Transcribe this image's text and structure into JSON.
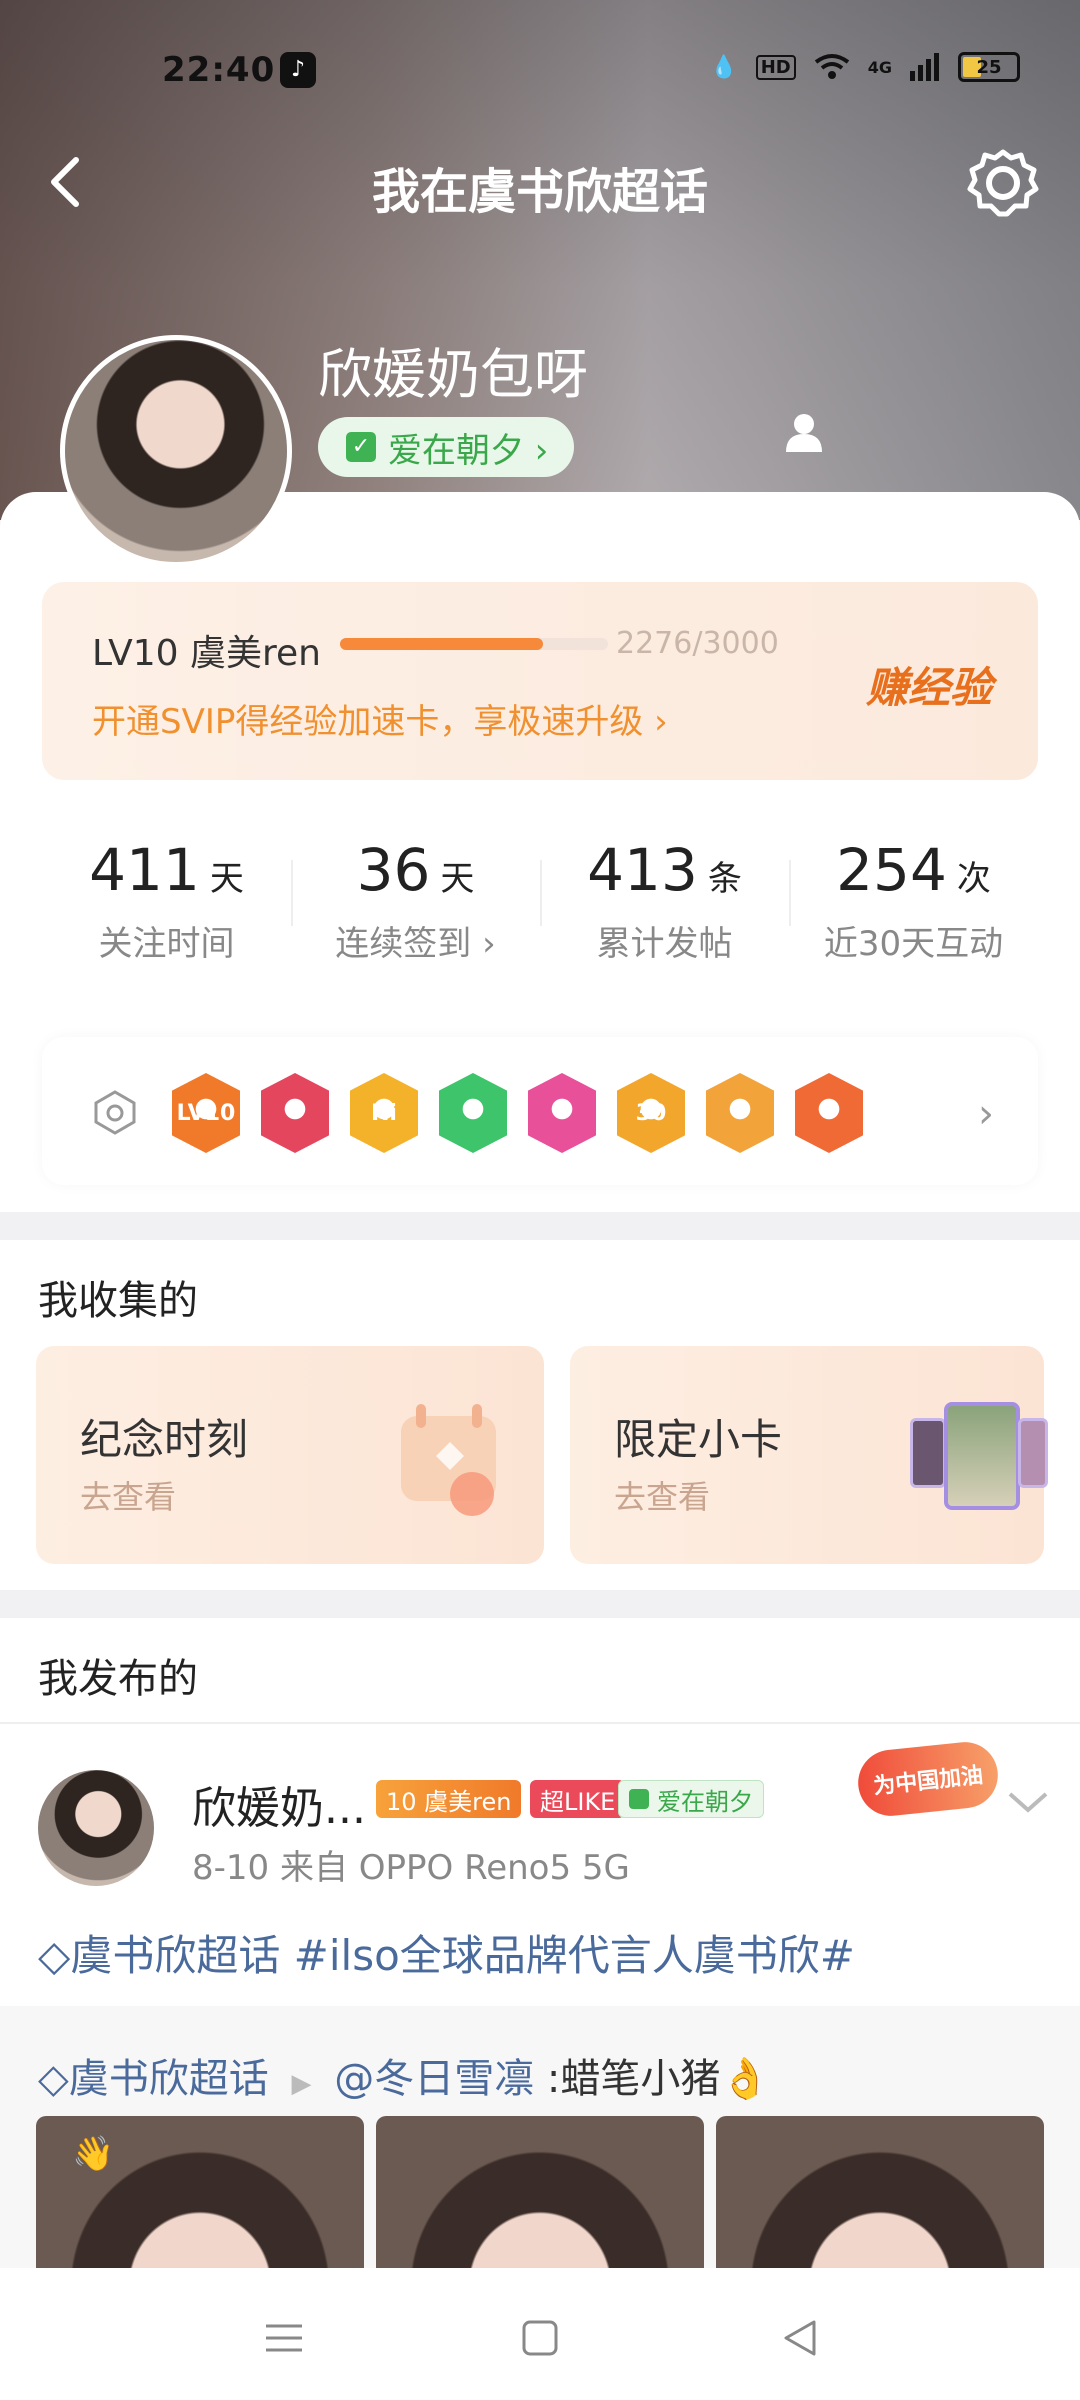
{
  "status_bar": {
    "time": "22:40",
    "battery": "25",
    "signal": "4G",
    "hd": "HD"
  },
  "header": {
    "title": "我在虞书欣超话"
  },
  "profile": {
    "name": "欣媛奶包呀",
    "tag": "爱在朝夕 ›"
  },
  "level": {
    "label": "LV10 虞美ren",
    "score": "2276/3000",
    "progress": 0.758,
    "tip": "开通SVIP得经验加速卡，享极速升级 ›",
    "earn": "赚经验"
  },
  "stats": [
    {
      "num": "411",
      "unit": "天",
      "label": "关注时间"
    },
    {
      "num": "36",
      "unit": "天",
      "label": "连续签到 ›"
    },
    {
      "num": "413",
      "unit": "条",
      "label": "累计发帖"
    },
    {
      "num": "254",
      "unit": "次",
      "label": "近30天互动"
    }
  ],
  "medals": [
    "LV10",
    "",
    "Hi",
    "",
    "",
    "30",
    "",
    ""
  ],
  "medal_colors": [
    "#f07a2a",
    "#e4465e",
    "#f4b12a",
    "#3ec46a",
    "#e8509a",
    "#f3a62c",
    "#f2a33a",
    "#f06a36"
  ],
  "collected": {
    "heading": "我收集的",
    "tiles": [
      {
        "title": "纪念时刻",
        "sub": "去查看"
      },
      {
        "title": "限定小卡",
        "sub": "去查看"
      }
    ]
  },
  "published": {
    "heading": "我发布的"
  },
  "post": {
    "author": "欣媛奶...",
    "badge_level": "10 虞美ren",
    "badge_like": "超LIKE",
    "badge_tag": "爱在朝夕",
    "sticker": "为中国加油",
    "meta": "8-10  来自 OPPO Reno5 5G",
    "text": "虞书欣超话 #ilso全球品牌代言人虞书欣#",
    "repost_topic": "虞书欣超话",
    "repost_user": "@冬日雪凛",
    "repost_text": " :蜡笔小猪"
  }
}
